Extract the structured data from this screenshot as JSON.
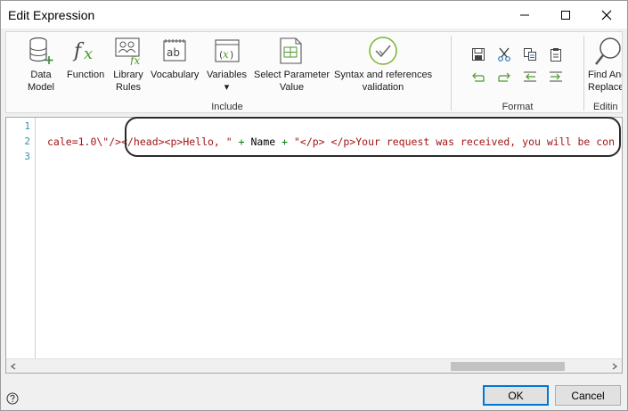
{
  "window": {
    "title": "Edit Expression"
  },
  "ribbon": {
    "include_group": {
      "label": "Include",
      "buttons": [
        {
          "label": "Data\nModel",
          "icon": "database-icon"
        },
        {
          "label": "Function",
          "icon": "function-icon"
        },
        {
          "label": "Library\nRules",
          "icon": "library-rules-icon"
        },
        {
          "label": "Vocabulary",
          "icon": "vocabulary-icon"
        },
        {
          "label": "Variables\n▾",
          "icon": "variables-icon"
        },
        {
          "label": "Select Parameter\nValue",
          "icon": "parameter-table-icon"
        },
        {
          "label": "Syntax and references\nvalidation",
          "icon": "validation-check-icon"
        }
      ]
    },
    "format_group": {
      "label": "Format",
      "buttons": [
        {
          "name": "save",
          "icon": "save-icon"
        },
        {
          "name": "cut",
          "icon": "scissors-icon"
        },
        {
          "name": "copy",
          "icon": "copy-icon"
        },
        {
          "name": "paste",
          "icon": "paste-icon"
        },
        {
          "name": "undo",
          "icon": "undo-icon"
        },
        {
          "name": "redo",
          "icon": "redo-icon"
        },
        {
          "name": "outdent",
          "icon": "outdent-icon"
        },
        {
          "name": "indent",
          "icon": "indent-icon"
        }
      ]
    },
    "editing_group": {
      "label": "Editin",
      "find_replace_label": "Find And\nReplace",
      "icon": "magnifier-icon"
    }
  },
  "editor": {
    "line_numbers": [
      "1",
      "2",
      "3"
    ],
    "line2": {
      "seg1": "cale=1.0\\\"/></head><p>Hello, \"",
      "seg2": " + ",
      "seg3": "Name",
      "seg4": " + ",
      "seg5": "\"</p> </p>Your request was received, you will be con"
    }
  },
  "footer": {
    "ok_label": "OK",
    "cancel_label": "Cancel",
    "help_icon": "question-circle-icon"
  },
  "colors": {
    "string": "#a31515",
    "operator": "#008000",
    "line_number": "#2b91af",
    "accent": "#0078d7"
  }
}
